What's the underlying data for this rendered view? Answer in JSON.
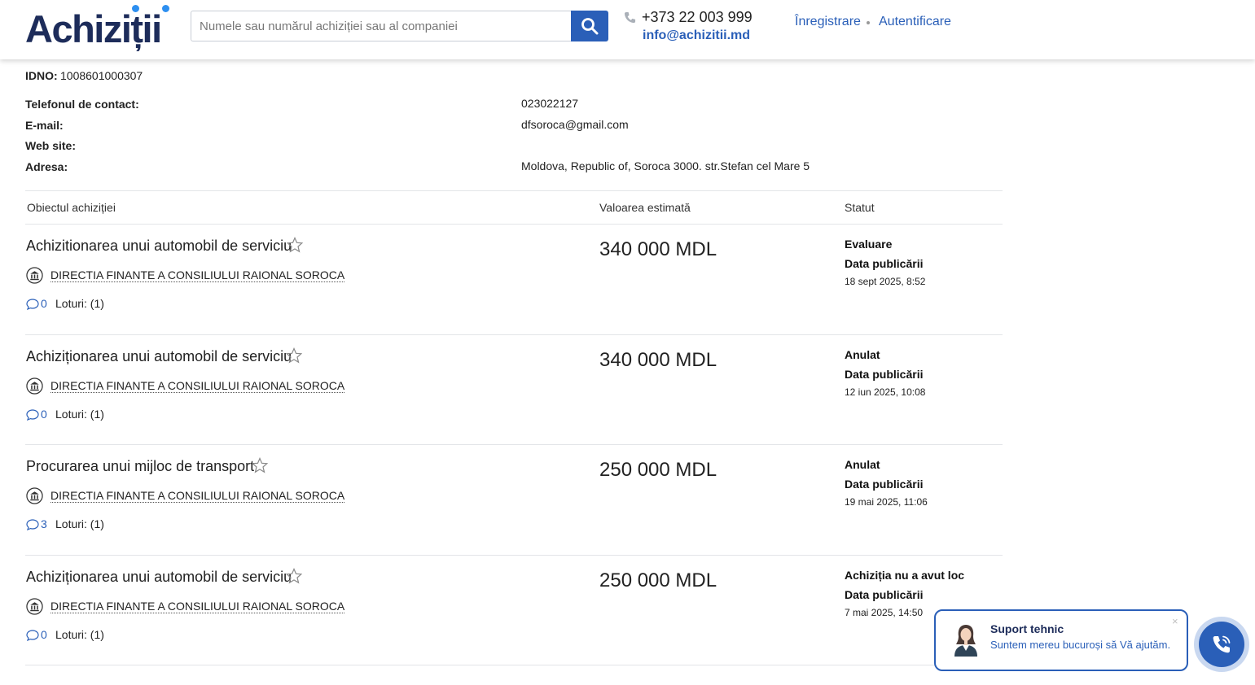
{
  "header": {
    "logo_text": "Achiziții",
    "search_placeholder": "Numele sau numărul achiziției sau al companiei",
    "phone": "+373 22 003 999",
    "email": "info@achizitii.md",
    "register_label": "Înregistrare",
    "login_label": "Autentificare"
  },
  "company": {
    "idno_label": "IDNO:",
    "idno_value": "1008601000307",
    "phone_label": "Telefonul de contact:",
    "phone_value": "023022127",
    "email_label": "E-mail:",
    "email_value": "dfsoroca@gmail.com",
    "website_label": "Web site:",
    "website_value": "",
    "address_label": "Adresa:",
    "address_value": "Moldova, Republic of, Soroca 3000. str.Stefan cel Mare 5"
  },
  "table": {
    "col_object": "Obiectul achiziției",
    "col_value": "Valoarea estimată",
    "col_status": "Statut",
    "rows": [
      {
        "title": "Achizitionarea unui automobil de serviciu",
        "org": "DIRECTIA FINANTE A CONSILIULUI RAIONAL SOROCA",
        "comments": "0",
        "lots": "Loturi: (1)",
        "price": "340 000 MDL",
        "status": "Evaluare",
        "pub_label": "Data publicării",
        "pub_date": "18 sept 2025, 8:52"
      },
      {
        "title": "Achiziționarea unui automobil de serviciu",
        "org": "DIRECTIA FINANTE A CONSILIULUI RAIONAL SOROCA",
        "comments": "0",
        "lots": "Loturi: (1)",
        "price": "340 000 MDL",
        "status": "Anulat",
        "pub_label": "Data publicării",
        "pub_date": "12 iun 2025, 10:08"
      },
      {
        "title": "Procurarea unui mijloc de transport",
        "org": "DIRECTIA FINANTE A CONSILIULUI RAIONAL SOROCA",
        "comments": "3",
        "lots": "Loturi: (1)",
        "price": "250 000 MDL",
        "status": "Anulat",
        "pub_label": "Data publicării",
        "pub_date": "19 mai 2025, 11:06"
      },
      {
        "title": "Achiziționarea unui automobil de serviciu",
        "org": "DIRECTIA FINANTE A CONSILIULUI RAIONAL SOROCA",
        "comments": "0",
        "lots": "Loturi: (1)",
        "price": "250 000 MDL",
        "status": "Achiziția nu a avut loc",
        "pub_label": "Data publicării",
        "pub_date": "7 mai 2025, 14:50"
      }
    ]
  },
  "support": {
    "title": "Suport tehnic",
    "subtitle": "Suntem mereu bucuroși să Vă ajutăm.",
    "close": "×"
  },
  "colors": {
    "brand_blue": "#2a5fb8",
    "logo_navy": "#1d2c5a"
  }
}
